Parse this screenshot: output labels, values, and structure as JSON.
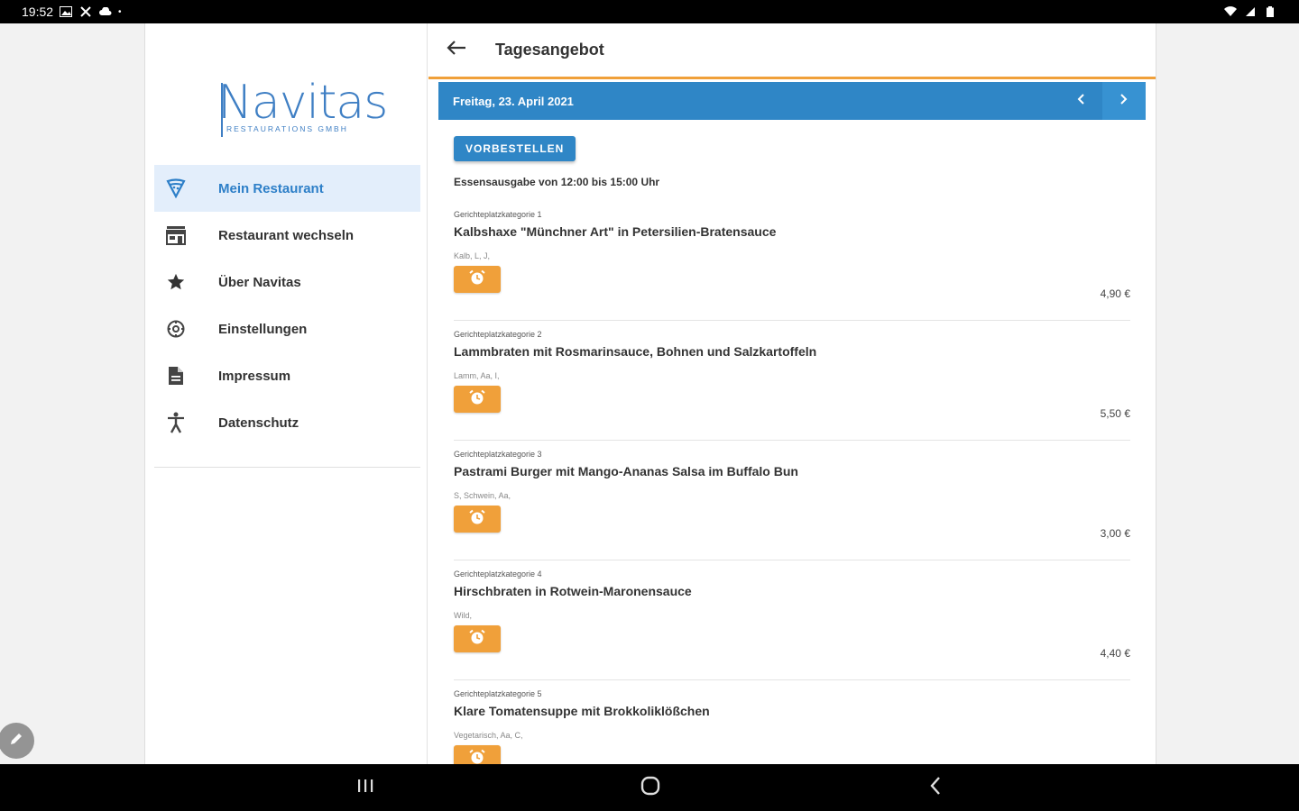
{
  "status_bar": {
    "time": "19:52"
  },
  "sidebar": {
    "logo": {
      "word": "Navitas",
      "subtitle": "RESTAURATIONS GMBH"
    },
    "items": [
      {
        "label": "Mein Restaurant",
        "icon": "pizza-slice-icon",
        "active": true
      },
      {
        "label": "Restaurant wechseln",
        "icon": "storefront-icon",
        "active": false
      },
      {
        "label": "Über Navitas",
        "icon": "star-icon",
        "active": false
      },
      {
        "label": "Einstellungen",
        "icon": "settings-icon",
        "active": false
      },
      {
        "label": "Impressum",
        "icon": "document-icon",
        "active": false
      },
      {
        "label": "Datenschutz",
        "icon": "accessibility-icon",
        "active": false
      }
    ]
  },
  "main": {
    "title": "Tagesangebot",
    "date": "Freitag, 23. April 2021",
    "preorder_label": "VORBESTELLEN",
    "serving_text": "Essensausgabe von 12:00 bis 15:00 Uhr",
    "dishes": [
      {
        "category": "Gerichteplatzkategorie 1",
        "name": "Kalbshaxe \"Münchner Art\" in Petersilien-Bratensauce",
        "tags": "Kalb, L, J,",
        "price": "4,90 €"
      },
      {
        "category": "Gerichteplatzkategorie 2",
        "name": "Lammbraten mit Rosmarinsauce, Bohnen und Salzkartoffeln",
        "tags": "Lamm, Aa, I,",
        "price": "5,50 €"
      },
      {
        "category": "Gerichteplatzkategorie 3",
        "name": "Pastrami Burger mit Mango-Ananas Salsa im Buffalo Bun",
        "tags": "S, Schwein, Aa,",
        "price": "3,00 €"
      },
      {
        "category": "Gerichteplatzkategorie 4",
        "name": "Hirschbraten in Rotwein-Maronensauce",
        "tags": "Wild,",
        "price": "4,40 €"
      },
      {
        "category": "Gerichteplatzkategorie 5",
        "name": "Klare Tomatensuppe mit Brokkoliklößchen",
        "tags": "Vegetarisch, Aa, C,",
        "price": ""
      }
    ]
  },
  "colors": {
    "primary_blue": "#2f86c6",
    "accent_orange": "#f0a03a",
    "active_bg": "#e3eefb"
  }
}
